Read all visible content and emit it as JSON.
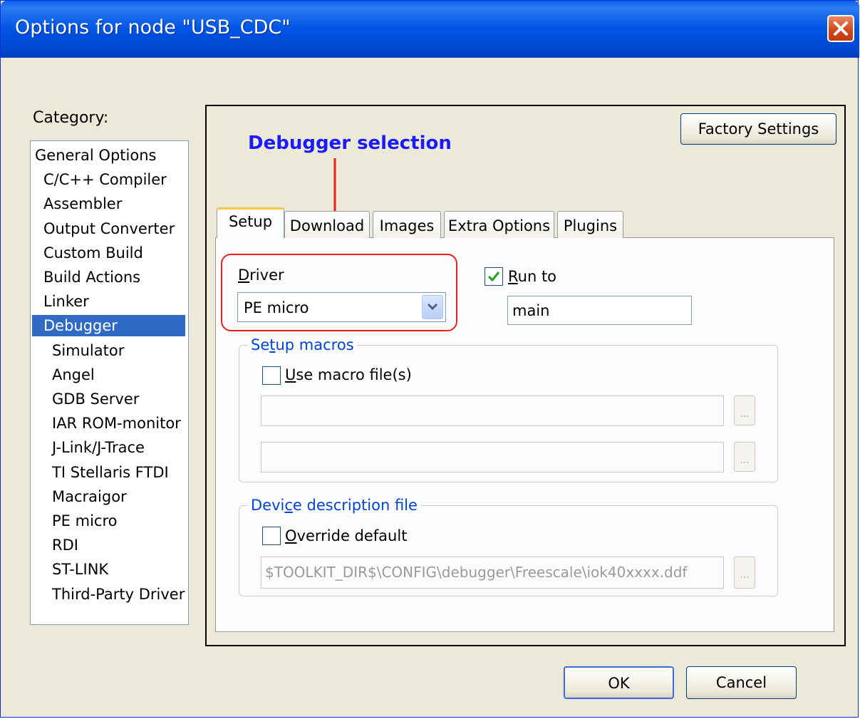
{
  "window": {
    "title": "Options for node \"USB_CDC\""
  },
  "category": {
    "label": "Category:",
    "items": [
      {
        "label": "General Options",
        "level": 0,
        "selected": false
      },
      {
        "label": "C/C++ Compiler",
        "level": 1,
        "selected": false
      },
      {
        "label": "Assembler",
        "level": 1,
        "selected": false
      },
      {
        "label": "Output Converter",
        "level": 1,
        "selected": false
      },
      {
        "label": "Custom Build",
        "level": 1,
        "selected": false
      },
      {
        "label": "Build Actions",
        "level": 1,
        "selected": false
      },
      {
        "label": "Linker",
        "level": 1,
        "selected": false
      },
      {
        "label": "Debugger",
        "level": 1,
        "selected": true
      },
      {
        "label": "Simulator",
        "level": 2,
        "selected": false
      },
      {
        "label": "Angel",
        "level": 2,
        "selected": false
      },
      {
        "label": "GDB Server",
        "level": 2,
        "selected": false
      },
      {
        "label": "IAR ROM-monitor",
        "level": 2,
        "selected": false
      },
      {
        "label": "J-Link/J-Trace",
        "level": 2,
        "selected": false
      },
      {
        "label": "TI Stellaris FTDI",
        "level": 2,
        "selected": false
      },
      {
        "label": "Macraigor",
        "level": 2,
        "selected": false
      },
      {
        "label": "PE micro",
        "level": 2,
        "selected": false
      },
      {
        "label": "RDI",
        "level": 2,
        "selected": false
      },
      {
        "label": "ST-LINK",
        "level": 2,
        "selected": false
      },
      {
        "label": "Third-Party Driver",
        "level": 2,
        "selected": false
      }
    ]
  },
  "factory_settings_label": "Factory Settings",
  "annotation": "Debugger selection",
  "tabs": [
    {
      "label": "Setup",
      "active": true
    },
    {
      "label": "Download",
      "active": false
    },
    {
      "label": "Images",
      "active": false
    },
    {
      "label": "Extra Options",
      "active": false
    },
    {
      "label": "Plugins",
      "active": false
    }
  ],
  "driver": {
    "label": "Driver",
    "value": "PE micro"
  },
  "run_to": {
    "label": "Run to",
    "checked": true,
    "value": "main"
  },
  "setup_macros": {
    "title": "Setup macros",
    "checkbox_label": "Use macro file(s)",
    "checked": false,
    "field1": "",
    "field2": "",
    "browse_label": "..."
  },
  "device_description": {
    "title": "Device description file",
    "checkbox_label": "Override default",
    "checked": false,
    "path": "$TOOLKIT_DIR$\\CONFIG\\debugger\\Freescale\\iok40xxxx.ddf",
    "browse_label": "..."
  },
  "buttons": {
    "ok": "OK",
    "cancel": "Cancel"
  },
  "colors": {
    "selection": "#316ac5",
    "annotation": "#1a1aff",
    "highlight_box": "#e8201e",
    "group_title": "#0046d5"
  }
}
